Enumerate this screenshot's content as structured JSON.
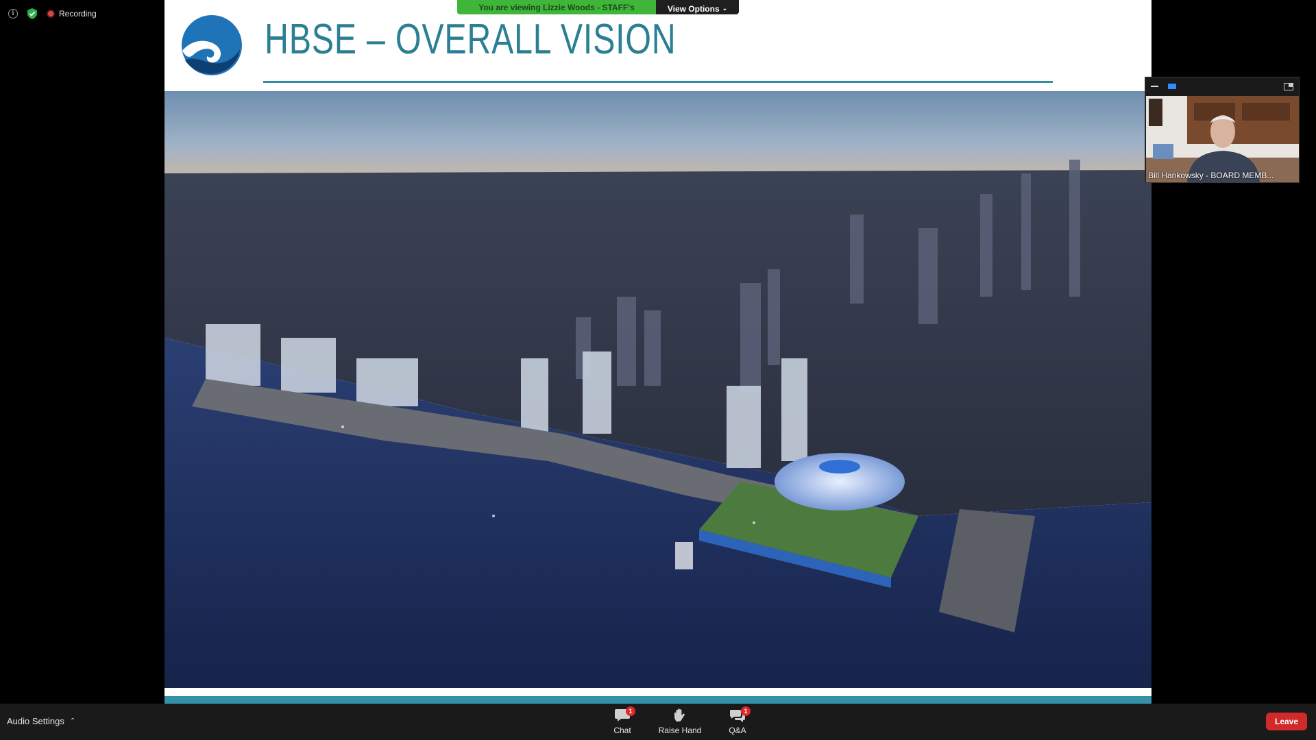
{
  "status": {
    "recording_label": "Recording"
  },
  "share_banner": {
    "text": "You are viewing Lizzie Woods - STAFF's screen",
    "view_options_label": "View Options"
  },
  "slide": {
    "title": "HBSE – OVERALL VISION",
    "accent_color": "#2a7f93"
  },
  "participant": {
    "name": "Bill Hankowsky - BOARD MEMB..."
  },
  "bottom_bar": {
    "audio_settings_label": "Audio Settings",
    "controls": [
      {
        "label": "Chat",
        "badge": "1",
        "icon": "chat-icon"
      },
      {
        "label": "Raise Hand",
        "badge": "",
        "icon": "raise-hand-icon"
      },
      {
        "label": "Q&A",
        "badge": "1",
        "icon": "qa-icon"
      }
    ],
    "leave_label": "Leave"
  }
}
